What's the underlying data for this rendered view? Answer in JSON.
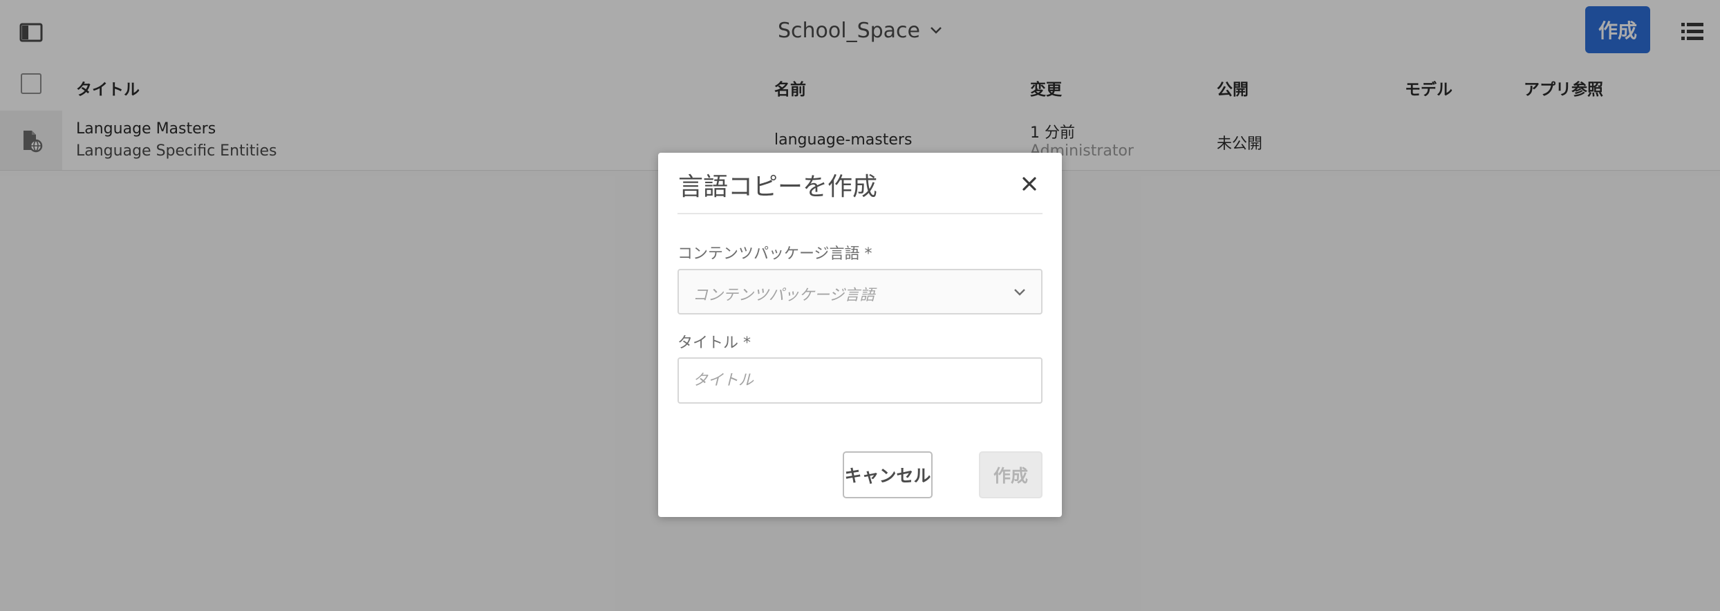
{
  "header": {
    "space_name": "School_Space",
    "create_label": "作成",
    "icons": {
      "rail": "panel-toggle-icon",
      "switcher": "chevron-down-icon",
      "view": "list-view-icon"
    }
  },
  "table": {
    "columns": [
      "タイトル",
      "名前",
      "変更",
      "公開",
      "モデル",
      "アプリ参照"
    ],
    "rows": [
      {
        "icon": "language-masters-icon",
        "title": "Language Masters",
        "subtitle": "Language Specific Entities",
        "name": "language-masters",
        "modified": "1 分前",
        "modified_by": "Administrator",
        "published": "未公開",
        "model": "",
        "app_refs": ""
      }
    ]
  },
  "dialog": {
    "title": "言語コピーを作成",
    "close_icon": "close-icon",
    "language_label": "コンテンツパッケージ言語 *",
    "language_placeholder": "コンテンツパッケージ言語",
    "title_label": "タイトル *",
    "title_placeholder": "タイトル",
    "title_value": "",
    "cancel_label": "キャンセル",
    "create_label": "作成"
  },
  "colors": {
    "accent": "#2d6fd9",
    "overlay": "rgba(0,0,0,0.33)"
  }
}
